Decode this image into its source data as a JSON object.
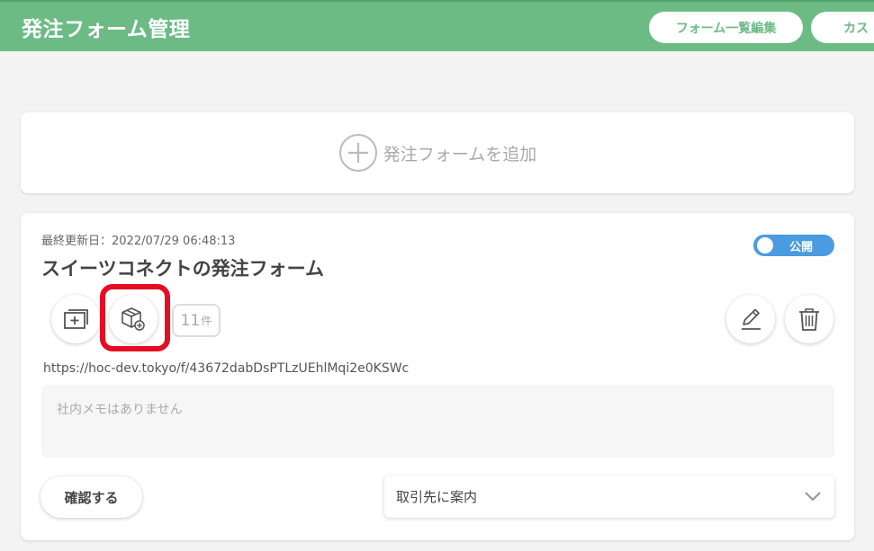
{
  "header": {
    "title": "発注フォーム管理",
    "buttons": [
      {
        "label": "フォーム一覧編集"
      },
      {
        "label": "カス"
      }
    ]
  },
  "add_form": {
    "label": "発注フォームを追加",
    "icon": "plus-circle-icon"
  },
  "form_card": {
    "updated_label": "最終更新日：2022/07/29 06:48:13",
    "title": "スイーツコネクトの発注フォーム",
    "status_label": "公開",
    "status_on": true,
    "product_count": "11",
    "product_count_unit": "件",
    "url": "https://hoc-dev.tokyo/f/43672dabDsPTLzUEhlMqi2e0KSWc",
    "memo_placeholder": "社内メモはありません",
    "confirm_label": "確認する",
    "select_value": "取引先に案内"
  },
  "colors": {
    "header_green": "#6cbb85",
    "toggle_blue": "#4a9be0",
    "highlight_red": "#e60d23"
  }
}
